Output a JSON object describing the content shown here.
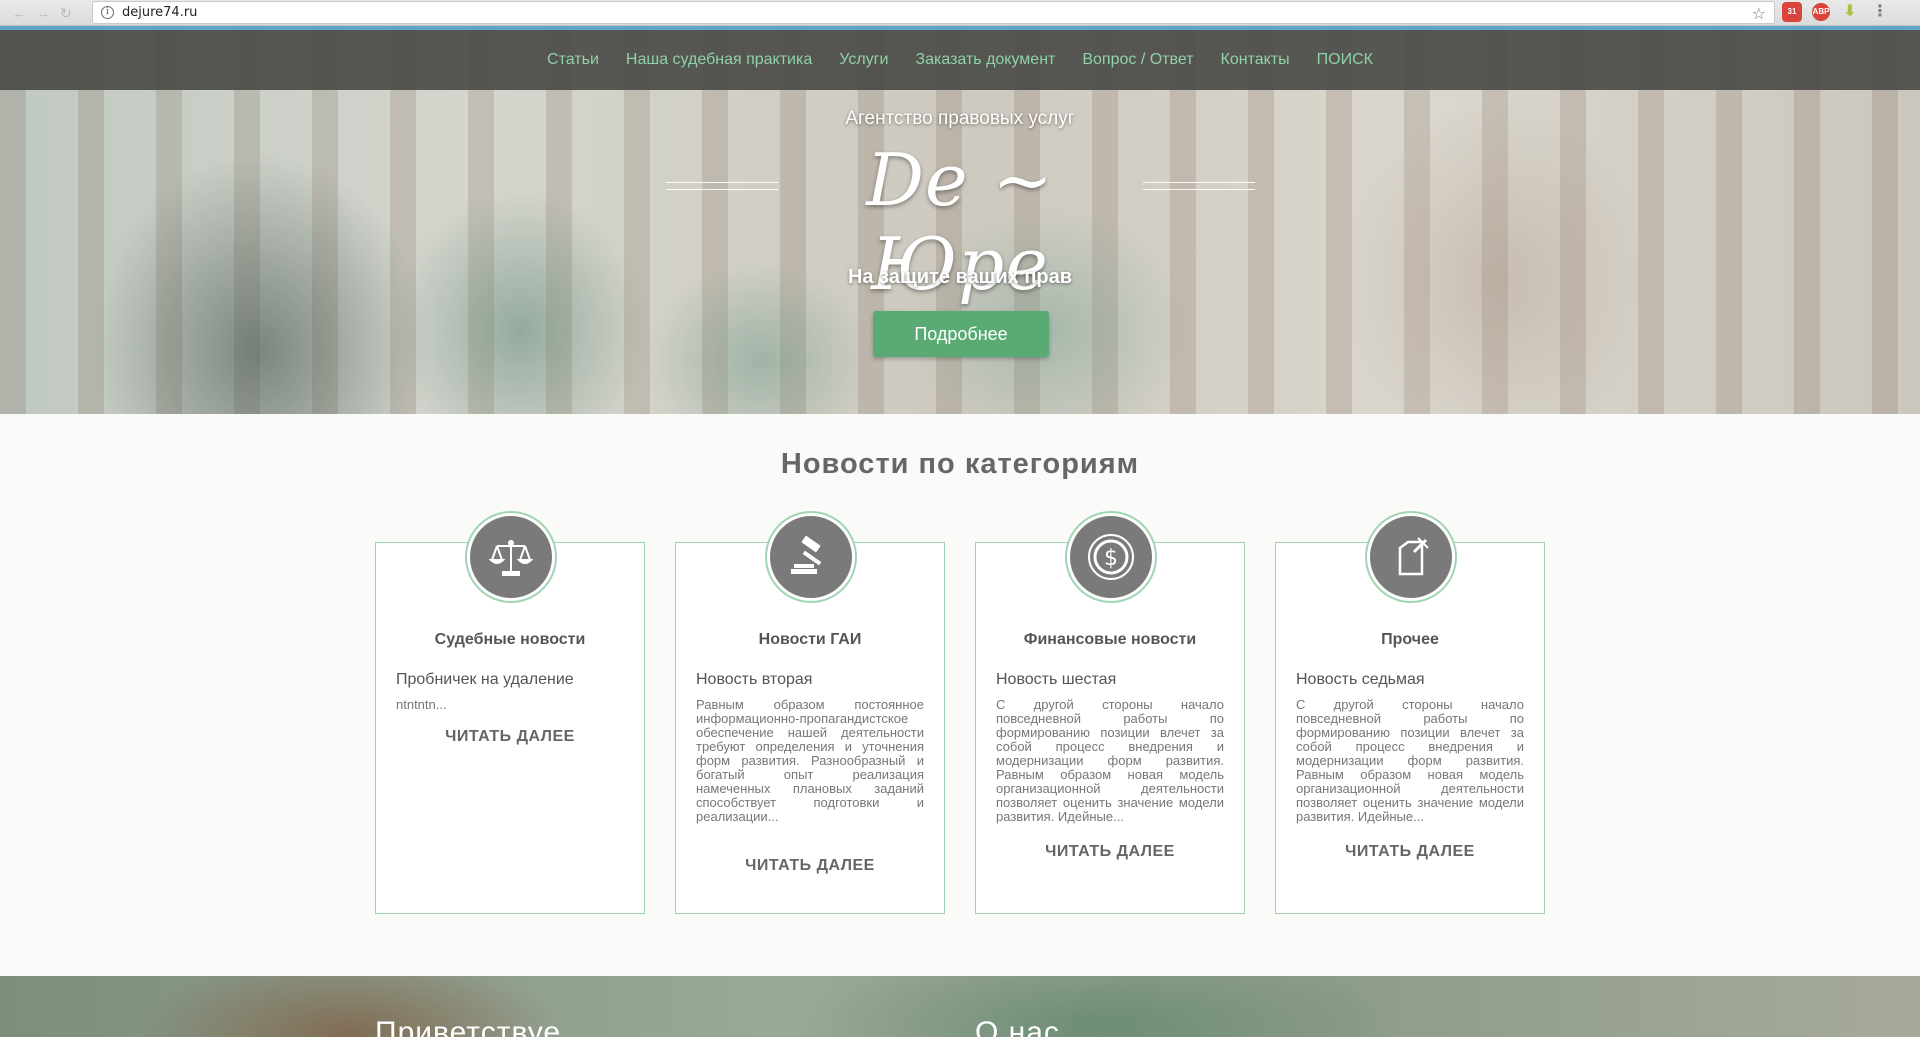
{
  "browser": {
    "url": "dejure74.ru",
    "extensions": [
      "31",
      "ABP"
    ]
  },
  "nav": {
    "items": [
      "Статьи",
      "Наша судебная практика",
      "Услуги",
      "Заказать документ",
      "Вопрос / Ответ",
      "Контакты",
      "ПОИСК"
    ]
  },
  "hero": {
    "agency": "Агентство правовых услуг",
    "logo": "De ~ Юре",
    "tagline": "На защите ваших прав",
    "button": "Подробнее"
  },
  "news": {
    "title": "Новости по категориям",
    "cards": [
      {
        "icon": "scales-icon",
        "title": "Судебные новости",
        "subtitle": "Пробничек на удаление",
        "text": "ntntntn...",
        "more": "ЧИТАТЬ ДАЛЕЕ"
      },
      {
        "icon": "gavel-icon",
        "title": "Новости ГАИ",
        "subtitle": "Новость вторая",
        "text": "Равным образом постоянное информационно-пропагандистское обеспечение нашей деятельности требуют определения и уточнения форм развития. Разнообразный и богатый опыт реализация намеченных плановых заданий способствует подготовки и реализации...",
        "more": "ЧИТАТЬ ДАЛЕЕ"
      },
      {
        "icon": "dollar-icon",
        "title": "Финансовые новости",
        "subtitle": "Новость шестая",
        "text": "С другой стороны начало повседневной работы по формированию позиции влечет за собой процесс внедрения и модернизации форм развития. Равным образом новая модель организационной деятельности позволяет оценить значение модели развития. Идейные...",
        "more": "ЧИТАТЬ ДАЛЕЕ"
      },
      {
        "icon": "document-icon",
        "title": "Прочее",
        "subtitle": "Новость седьмая",
        "text": "С другой стороны начало повседневной работы по формированию позиции влечет за собой процесс внедрения и модернизации форм развития. Равным образом новая модель организационной деятельности позволяет оценить значение модели развития. Идейные...",
        "more": "ЧИТАТЬ ДАЛЕЕ"
      }
    ]
  },
  "bottom": {
    "left_heading": "Приветствуе",
    "right_heading": "О нас"
  },
  "colors": {
    "nav_link": "#8fd1a8",
    "button": "#5aaa74",
    "card_border": "#9fd5b2",
    "icon_bg": "#7a7a7a"
  }
}
